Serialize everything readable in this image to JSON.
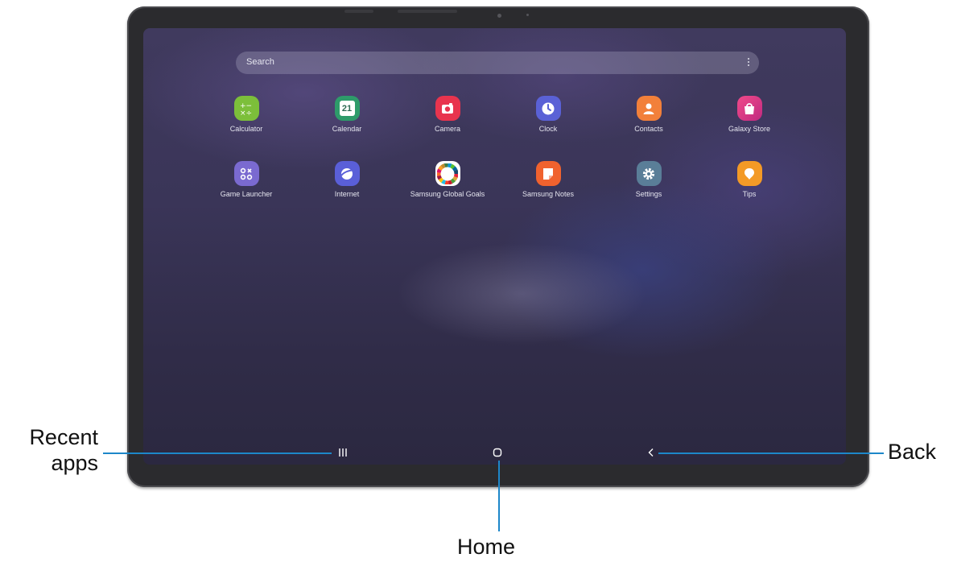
{
  "search": {
    "placeholder": "Search"
  },
  "apps": [
    {
      "label": "Calculator",
      "icon": "calculator-icon",
      "color": "#7cbf3a"
    },
    {
      "label": "Calendar",
      "icon": "calendar-icon",
      "color": "#2e9b6a",
      "day": "21"
    },
    {
      "label": "Camera",
      "icon": "camera-icon",
      "color": "#e8344e"
    },
    {
      "label": "Clock",
      "icon": "clock-icon",
      "color": "#5a61d6"
    },
    {
      "label": "Contacts",
      "icon": "contacts-icon",
      "color": "#f2803a"
    },
    {
      "label": "Galaxy Store",
      "icon": "galaxy-store-icon",
      "color": "#e8357e"
    },
    {
      "label": "Game Launcher",
      "icon": "game-launcher-icon",
      "color": "#7a6ad0"
    },
    {
      "label": "Internet",
      "icon": "internet-icon",
      "color": "#5a5fd8"
    },
    {
      "label": "Samsung Global Goals",
      "icon": "global-goals-icon",
      "color": "#ffffff"
    },
    {
      "label": "Samsung Notes",
      "icon": "notes-icon",
      "color": "#f0622e"
    },
    {
      "label": "Settings",
      "icon": "settings-icon",
      "color": "#5a7e98"
    },
    {
      "label": "Tips",
      "icon": "tips-icon",
      "color": "#f39a26"
    }
  ],
  "callouts": {
    "recent": "Recent\napps",
    "home": "Home",
    "back": "Back"
  },
  "colors": {
    "callout_line": "#1d87c9"
  }
}
